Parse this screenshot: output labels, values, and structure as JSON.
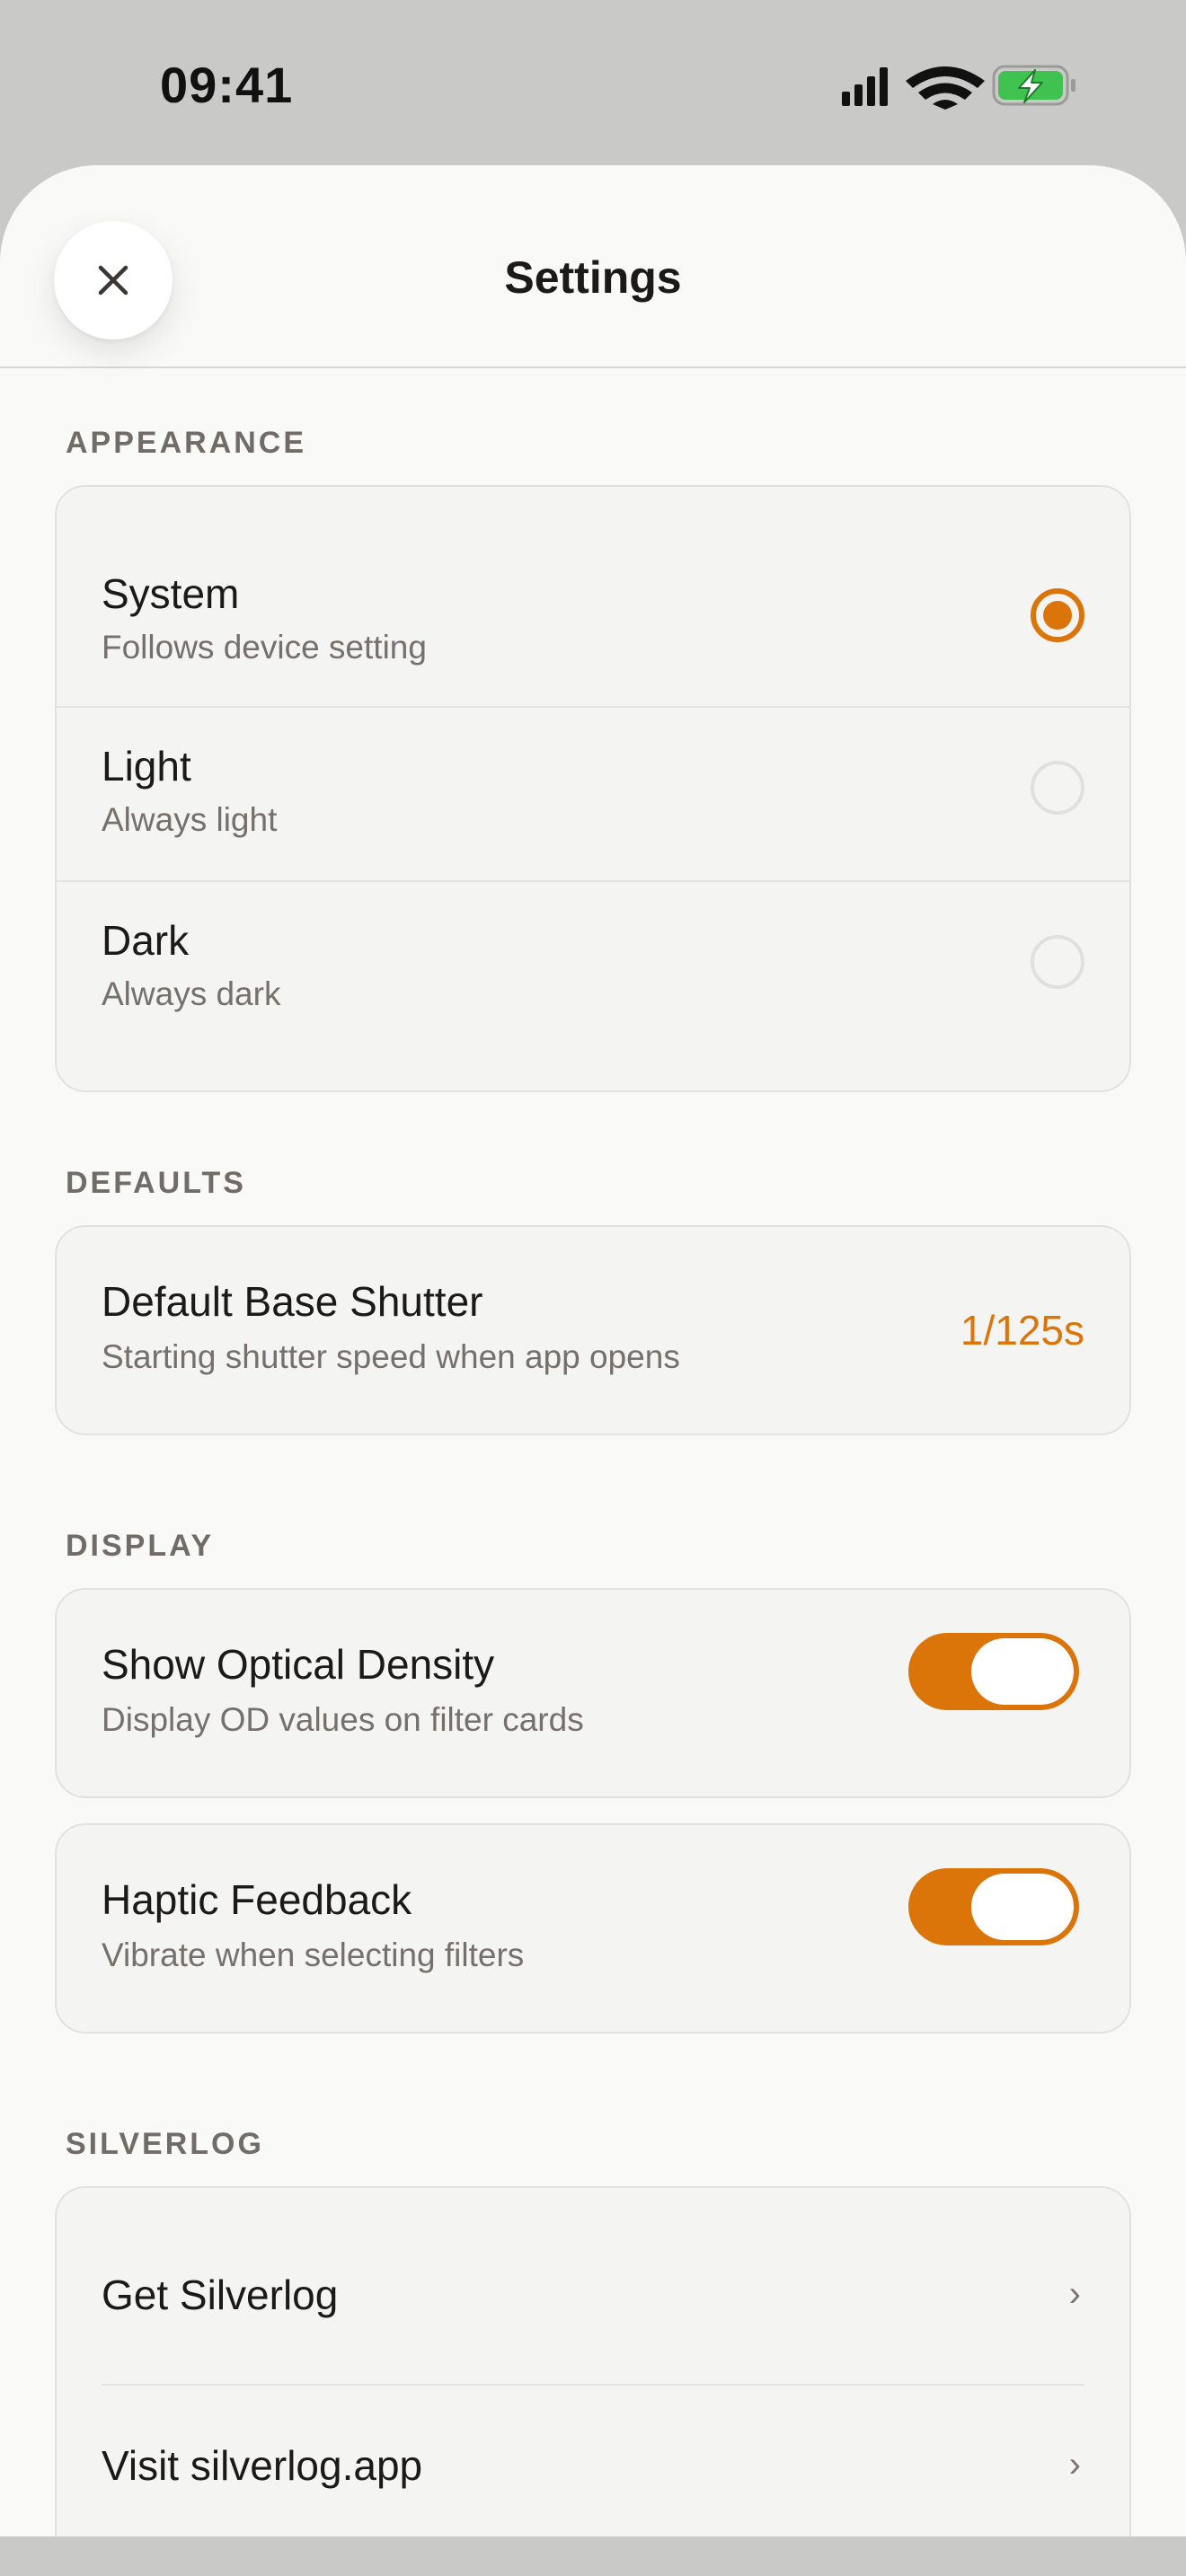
{
  "status_bar": {
    "time": "09:41"
  },
  "header": {
    "title": "Settings",
    "close_icon": "close-icon"
  },
  "appearance": {
    "section_title": "APPEARANCE",
    "options": [
      {
        "label": "System",
        "subtitle": "Follows device setting",
        "selected": true
      },
      {
        "label": "Light",
        "subtitle": "Always light",
        "selected": false
      },
      {
        "label": "Dark",
        "subtitle": "Always dark",
        "selected": false
      }
    ]
  },
  "defaults": {
    "section_title": "DEFAULTS",
    "base_shutter": {
      "label": "Default Base Shutter",
      "subtitle": "Starting shutter speed when app opens",
      "value": "1/125s"
    }
  },
  "display": {
    "section_title": "DISPLAY",
    "optical_density": {
      "label": "Show Optical Density",
      "subtitle": "Display OD values on filter cards",
      "enabled": true
    },
    "haptic_feedback": {
      "label": "Haptic Feedback",
      "subtitle": "Vibrate when selecting filters",
      "enabled": true
    }
  },
  "silverlog": {
    "section_title": "SILVERLOG",
    "links": [
      {
        "label": "Get Silverlog",
        "chevron": "›"
      },
      {
        "label": "Visit silverlog.app",
        "chevron": "›"
      }
    ]
  },
  "colors": {
    "accent": "#db7509",
    "sheet_background": "#f9f9f7",
    "card_background": "#f4f4f2",
    "status_bar_background": "#c9c9c8",
    "battery_fill": "#3fc24f"
  }
}
